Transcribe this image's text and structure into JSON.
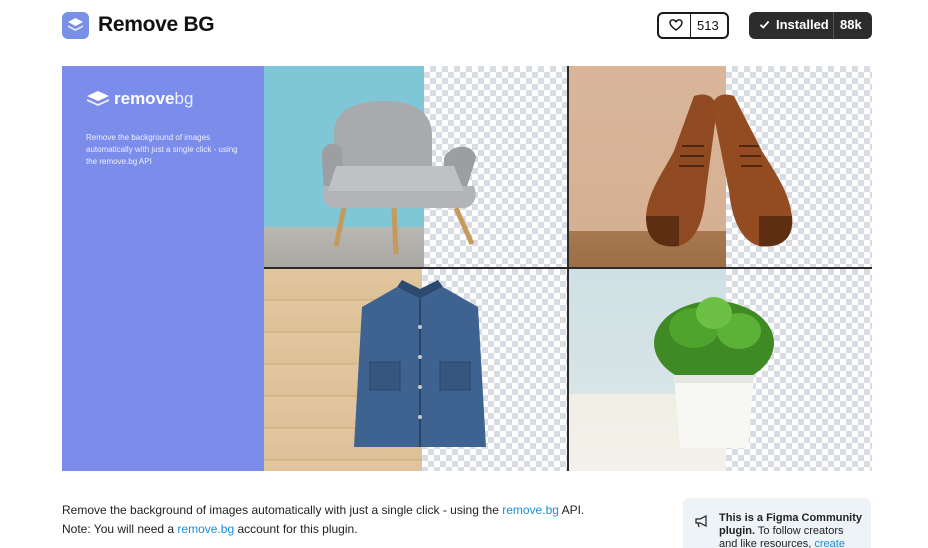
{
  "plugin": {
    "title": "Remove BG",
    "icon": "stacked-layers-icon"
  },
  "actions": {
    "like_count": "513",
    "installed_label": "Installed",
    "users_count": "88k"
  },
  "hero": {
    "brand_bold": "remove",
    "brand_light": "bg",
    "tagline": "Remove the background of images automatically with just a single click - using the remove.bg API",
    "accent": "#7b8cea"
  },
  "description": {
    "line1_prefix": "Remove the background of images automatically with just a single click - using the ",
    "line1_link": "remove.bg",
    "line1_suffix": " API.",
    "line2_prefix": "Note: You will need a ",
    "line2_link": "remove.bg",
    "line2_suffix": " account for this plugin."
  },
  "community": {
    "bold": "This is a Figma Community plugin.",
    "text": " To follow creators and like resources, ",
    "link": "create"
  }
}
